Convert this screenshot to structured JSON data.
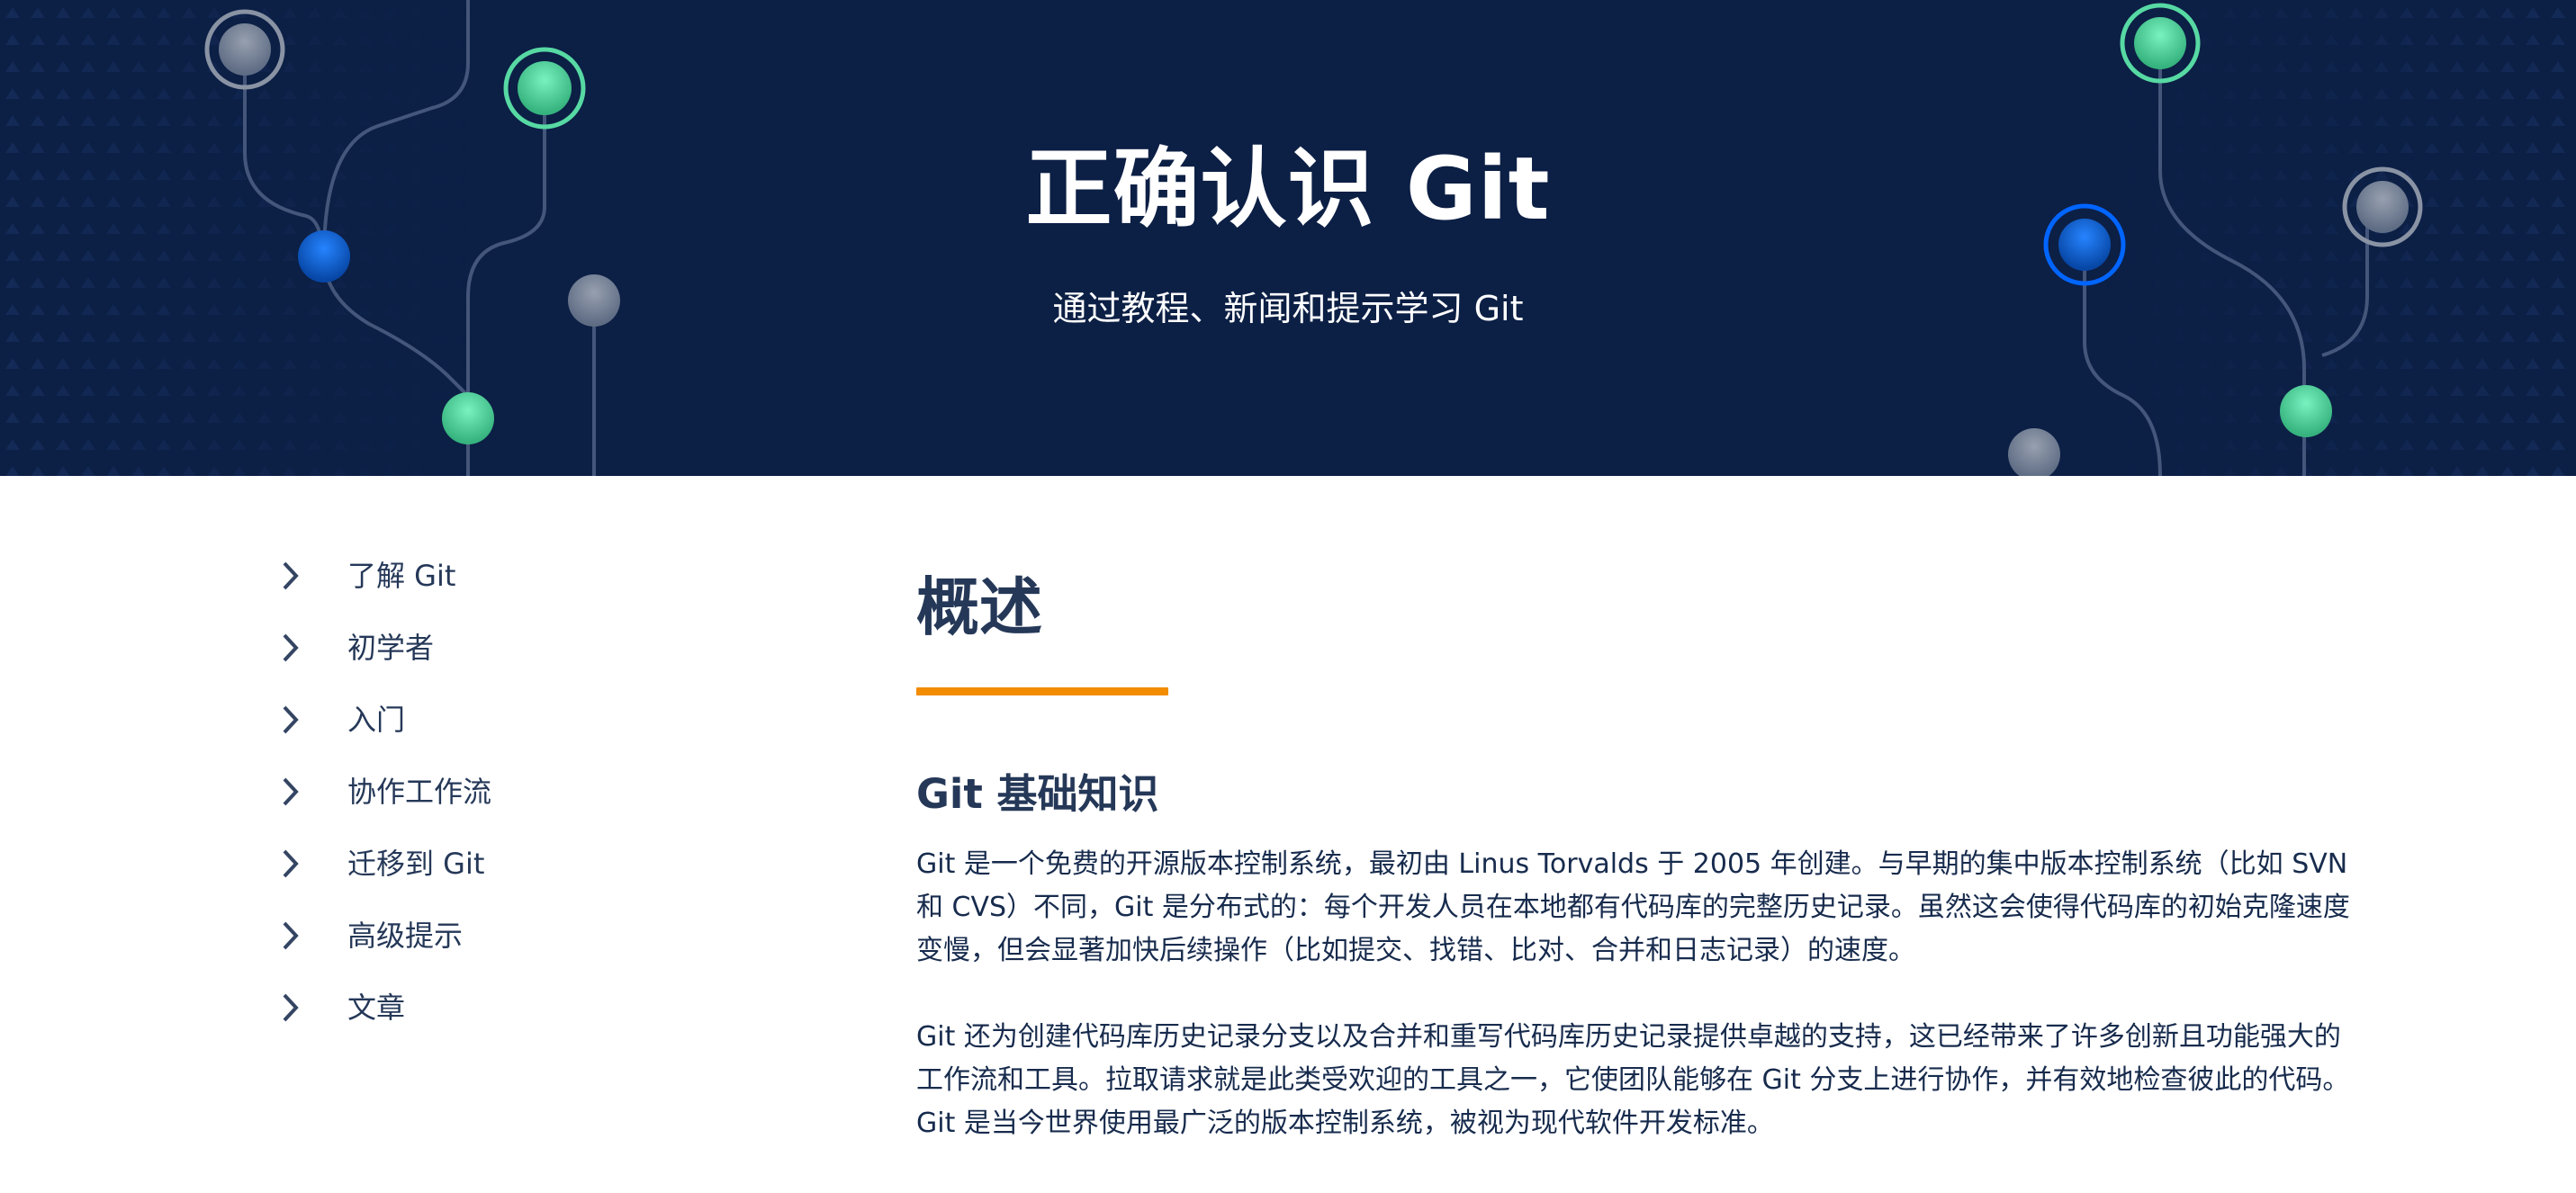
{
  "hero": {
    "title": "正确认识 Git",
    "subtitle": "通过教程、新闻和提示学习 Git",
    "colors": {
      "background": "#0c1f45",
      "green": "#57d9a3",
      "blue": "#0065ff",
      "gray": "#6b778c"
    }
  },
  "sidebar": {
    "items": [
      {
        "label": "了解 Git",
        "icon": "chevron-right-icon"
      },
      {
        "label": "初学者",
        "icon": "chevron-right-icon"
      },
      {
        "label": "入门",
        "icon": "chevron-right-icon"
      },
      {
        "label": "协作工作流",
        "icon": "chevron-right-icon"
      },
      {
        "label": "迁移到 Git",
        "icon": "chevron-right-icon"
      },
      {
        "label": "高级提示",
        "icon": "chevron-right-icon"
      },
      {
        "label": "文章",
        "icon": "chevron-right-icon"
      }
    ]
  },
  "main": {
    "heading": "概述",
    "accent_color": "#f28c00",
    "section_title": "Git 基础知识",
    "paragraphs": [
      "Git 是一个免费的开源版本控制系统，最初由 Linus Torvalds 于 2005 年创建。与早期的集中版本控制系统（比如 SVN 和 CVS）不同，Git 是分布式的：每个开发人员在本地都有代码库的完整历史记录。虽然这会使得代码库的初始克隆速度变慢，但会显著加快后续操作（比如提交、找错、比对、合并和日志记录）的速度。",
      "Git 还为创建代码库历史记录分支以及合并和重写代码库历史记录提供卓越的支持，这已经带来了许多创新且功能强大的工作流和工具。拉取请求就是此类受欢迎的工具之一，它使团队能够在 Git 分支上进行协作，并有效地检查彼此的代码。Git 是当今世界使用最广泛的版本控制系统，被视为现代软件开发标准。"
    ]
  }
}
